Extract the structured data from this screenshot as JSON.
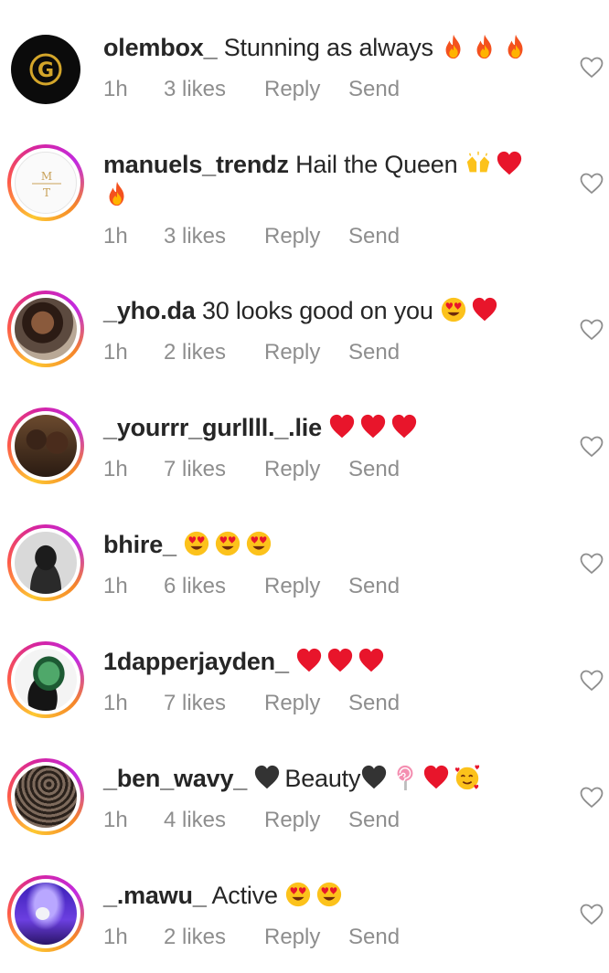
{
  "comments": [
    {
      "username": "olembox_",
      "text": "Stunning as always",
      "emojis": [
        "fire",
        "fire",
        "fire"
      ],
      "time": "1h",
      "likes": "3 likes",
      "reply": "Reply",
      "send": "Send",
      "avatar": "logo"
    },
    {
      "username": "manuels_trendz",
      "text": "Hail the Queen",
      "emojis": [
        "hands",
        "heart"
      ],
      "emojis2": [
        "fire"
      ],
      "time": "1h",
      "likes": "3 likes",
      "reply": "Reply",
      "send": "Send",
      "avatar": "monogram",
      "monogram_top": "M",
      "monogram_bottom": "T"
    },
    {
      "username": "_yho.da",
      "text": "30 looks good on you",
      "emojis": [
        "heart-eyes",
        "heart"
      ],
      "time": "1h",
      "likes": "2 likes",
      "reply": "Reply",
      "send": "Send",
      "avatar": "photo"
    },
    {
      "username": "_yourrr_gurllll._.lie",
      "text": "",
      "emojis": [
        "heart",
        "heart",
        "heart"
      ],
      "time": "1h",
      "likes": "7 likes",
      "reply": "Reply",
      "send": "Send",
      "avatar": "photo"
    },
    {
      "username": "bhire_",
      "text": "",
      "emojis": [
        "heart-eyes",
        "heart-eyes",
        "heart-eyes"
      ],
      "time": "1h",
      "likes": "6 likes",
      "reply": "Reply",
      "send": "Send",
      "avatar": "photo"
    },
    {
      "username": "1dapperjayden_",
      "text": "",
      "emojis": [
        "heart",
        "heart",
        "heart"
      ],
      "time": "1h",
      "likes": "7 likes",
      "reply": "Reply",
      "send": "Send",
      "avatar": "photo"
    },
    {
      "username": "_ben_wavy_",
      "text": "Beauty",
      "emojis": [
        "black-heart"
      ],
      "emojis2": [
        "black-heart",
        "lollipop",
        "heart",
        "smiling-hearts"
      ],
      "time": "1h",
      "likes": "4 likes",
      "reply": "Reply",
      "send": "Send",
      "avatar": "photo"
    },
    {
      "username": "_.mawu_",
      "text": "Active",
      "emojis": [
        "heart-eyes",
        "heart-eyes"
      ],
      "time": "1h",
      "likes": "2 likes",
      "reply": "Reply",
      "send": "Send",
      "avatar": "photo"
    }
  ],
  "colors": {
    "text": "#262626",
    "meta": "#8e8e8e",
    "heart_outline": "#8e8e8e"
  },
  "icons": {
    "like": "heart-outline-icon"
  }
}
